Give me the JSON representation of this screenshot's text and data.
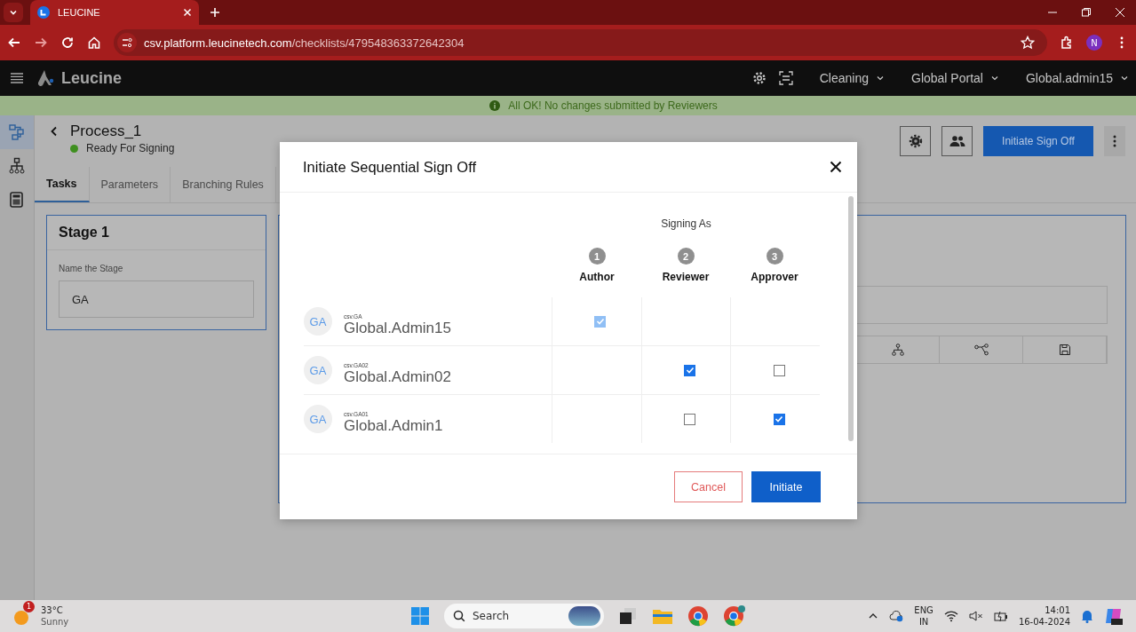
{
  "browser": {
    "tab_title": "LEUCINE",
    "url_host": "csv.platform.leucinetech.com",
    "url_path": "/checklists/479548363372642304",
    "profile_initial": "N"
  },
  "header": {
    "brand": "Leucine",
    "menus": [
      {
        "label": "Cleaning"
      },
      {
        "label": "Global Portal"
      },
      {
        "label": "Global.admin15"
      }
    ]
  },
  "banner": "All OK! No changes submitted by Reviewers",
  "sidebar": {
    "items": [
      {
        "kind": "flow",
        "selected": true
      },
      {
        "kind": "hierarchy",
        "selected": false
      },
      {
        "kind": "calculator",
        "selected": false
      }
    ]
  },
  "process": {
    "title": "Process_1",
    "status": "Ready For Signing",
    "color": "#3f8f1f",
    "primary_button": "Initiate Sign Off"
  },
  "tabs": [
    {
      "label": "Tasks",
      "selected": true
    },
    {
      "label": "Parameters",
      "selected": false
    },
    {
      "label": "Branching Rules",
      "selected": false
    }
  ],
  "stage": {
    "title": "Stage 1",
    "field_label": "Name the Stage",
    "value": "GA"
  },
  "modal": {
    "title": "Initiate Sequential Sign Off",
    "signing_as": "Signing As",
    "roles": [
      {
        "number": "1",
        "label": "Author"
      },
      {
        "number": "2",
        "label": "Reviewer"
      },
      {
        "number": "3",
        "label": "Approver"
      }
    ],
    "users": [
      {
        "initials": "GA",
        "username": "csv.GA",
        "name": "Global.Admin15",
        "cells": [
          {
            "kind": "checkbox",
            "checked": true,
            "disabled": true
          },
          {
            "kind": "empty"
          },
          {
            "kind": "empty"
          }
        ]
      },
      {
        "initials": "GA",
        "username": "csv.GA02",
        "name": "Global.Admin02",
        "cells": [
          {
            "kind": "empty"
          },
          {
            "kind": "checkbox",
            "checked": true,
            "disabled": false
          },
          {
            "kind": "checkbox",
            "checked": false,
            "disabled": false
          }
        ]
      },
      {
        "initials": "GA",
        "username": "csv.GA01",
        "name": "Global.Admin1",
        "cells": [
          {
            "kind": "empty"
          },
          {
            "kind": "checkbox",
            "checked": false,
            "disabled": false
          },
          {
            "kind": "checkbox",
            "checked": true,
            "disabled": false
          }
        ]
      }
    ],
    "cancel": "Cancel",
    "confirm": "Initiate"
  },
  "taskbar": {
    "temperature": "33°C",
    "weather": "Sunny",
    "weather_badge": "1",
    "search_placeholder": "Search",
    "language": "ENG",
    "region": "IN",
    "time": "14:01",
    "date": "16-04-2024"
  }
}
